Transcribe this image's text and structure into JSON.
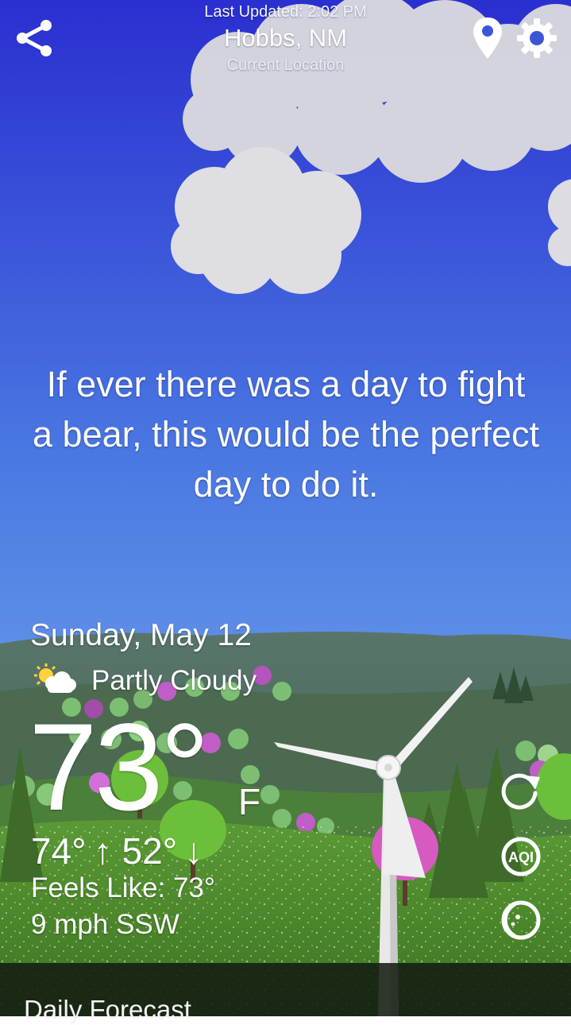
{
  "header": {
    "last_updated": "Last Updated: 2:02 PM",
    "city": "Hobbs, NM",
    "location_label": "Current Location"
  },
  "icons": {
    "share": "share-icon",
    "location_pin": "location-pin-icon",
    "settings": "gear-icon",
    "refresh": "refresh-icon",
    "aqi": "aqi-icon",
    "moon": "moon-phase-icon",
    "condition": "partly-cloudy-icon"
  },
  "quote": "If ever there was a day to fight a bear, this would be the perfect day to do it.",
  "weather": {
    "date": "Sunday, May 12",
    "condition": "Partly Cloudy",
    "temperature": "73°",
    "unit": "F",
    "high_low": "74° ↑ 52° ↓",
    "feels_like": "Feels Like: 73°",
    "wind": "9 mph SSW",
    "aqi_label": "AQI"
  },
  "footer": {
    "daily_forecast": "Daily Forecast"
  },
  "colors": {
    "sky_top": "#2a2fd0",
    "sky_bottom": "#7fb0f0",
    "hills": "#4f6a5c",
    "grass": "#4e8a2e"
  }
}
